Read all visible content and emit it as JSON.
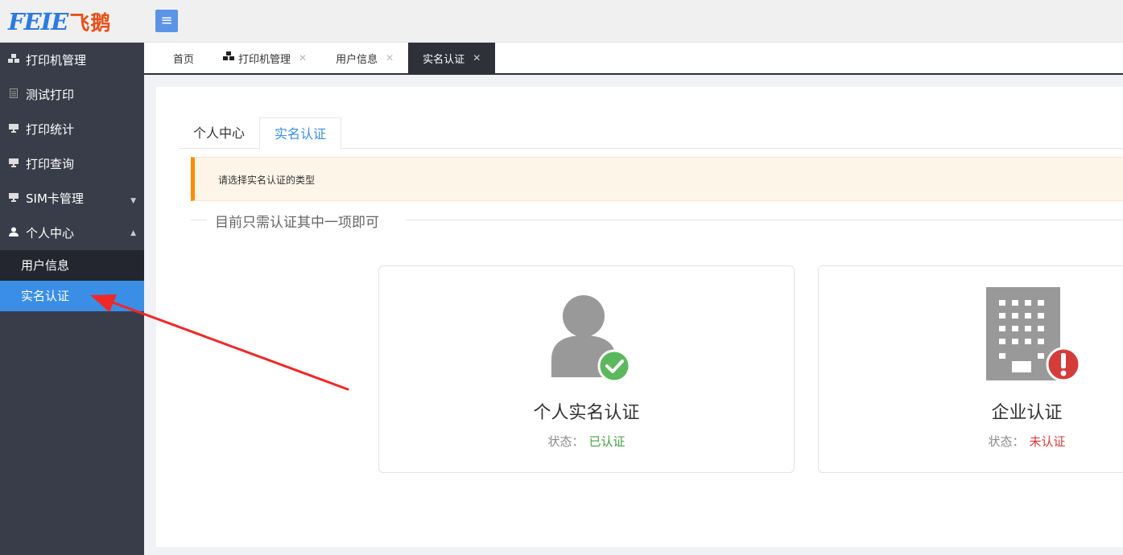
{
  "brand": {
    "latin": "FEIE",
    "cn": "飞鹅"
  },
  "header": {
    "menu_icon": "≡"
  },
  "sidebar": {
    "items": [
      {
        "label": "打印机管理",
        "icon": "cubes-icon"
      },
      {
        "label": "测试打印",
        "icon": "file-icon"
      },
      {
        "label": "打印统计",
        "icon": "monitor-icon"
      },
      {
        "label": "打印查询",
        "icon": "monitor-icon"
      },
      {
        "label": "SIM卡管理",
        "icon": "monitor-icon"
      },
      {
        "label": "个人中心",
        "icon": "user-icon"
      }
    ],
    "subitems": [
      {
        "label": "用户信息"
      },
      {
        "label": "实名认证"
      }
    ]
  },
  "tabs": [
    {
      "label": "首页"
    },
    {
      "label": "打印机管理"
    },
    {
      "label": "用户信息"
    },
    {
      "label": "实名认证"
    }
  ],
  "content": {
    "ctabs": [
      {
        "label": "个人中心"
      },
      {
        "label": "实名认证"
      }
    ],
    "notice": "请选择实名认证的类型",
    "divider": "目前只需认证其中一项即可",
    "cards": [
      {
        "title": "个人实名认证",
        "status_label": "状态：",
        "status_value": "已认证",
        "status_color": "#44a044"
      },
      {
        "title": "企业认证",
        "status_label": "状态：",
        "status_value": "未认证",
        "status_color": "#d43b3b"
      }
    ]
  },
  "colors": {
    "accent": "#3a8ee6",
    "sidebar": "#393d49",
    "warning": "#ff8c00"
  }
}
